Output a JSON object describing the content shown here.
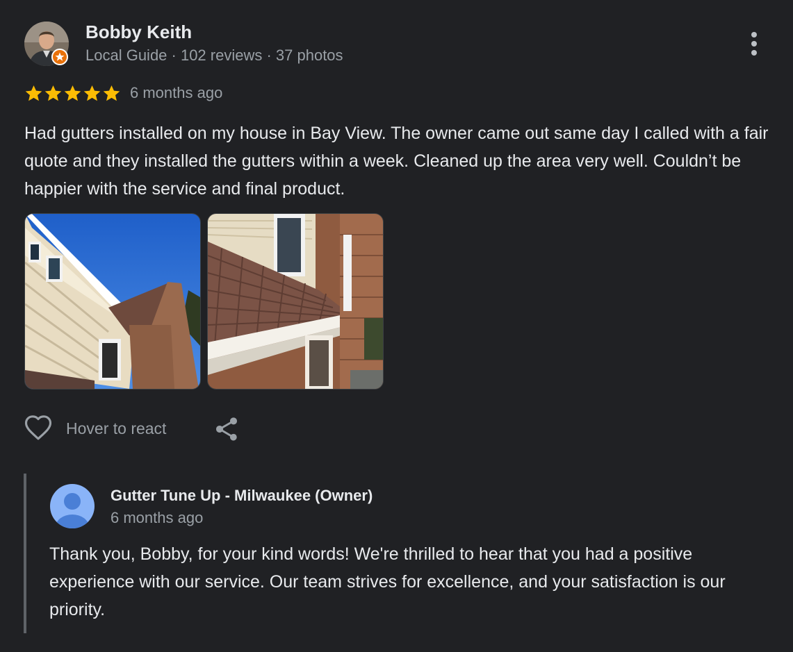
{
  "review": {
    "author": {
      "name": "Bobby Keith",
      "meta": "Local Guide · 102 reviews · 37 photos",
      "avatar_icon": "user-photo-avatar",
      "badge_icon": "local-guide-star-badge"
    },
    "rating": 5,
    "rating_max": 5,
    "time": "6 months ago",
    "text": "Had gutters installed on my house in Bay View. The owner came out same day I called with a fair quote and they installed the gutters within a week. Cleaned up the area very well. Couldn’t be happier with the service and final product.",
    "photos": [
      {
        "icon": "house-gutter-photo"
      },
      {
        "icon": "roof-gutter-closeup-photo"
      }
    ],
    "actions": {
      "react_label": "Hover to react",
      "react_icon": "heart-icon",
      "share_icon": "share-icon",
      "more_icon": "more-vert-icon"
    }
  },
  "owner_reply": {
    "name": "Gutter Tune Up - Milwaukee (Owner)",
    "time": "6 months ago",
    "text": "Thank you, Bobby, for your kind words! We're thrilled to hear that you had a positive experience with our service. Our team strives for excellence, and your satisfaction is our priority.",
    "avatar_icon": "default-person-avatar"
  },
  "colors": {
    "background": "#202124",
    "primary_text": "#e8eaed",
    "secondary_text": "#9aa0a6",
    "star": "#fbbc04",
    "guide_badge": "#e8710a",
    "default_avatar": "#8ab4f8"
  }
}
